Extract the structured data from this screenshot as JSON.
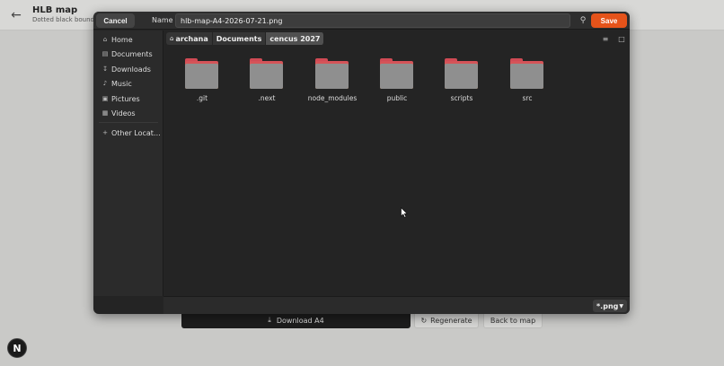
{
  "app": {
    "title": "HLB map",
    "subtitle": "Dotted black boundary",
    "buttons": {
      "download": "Download A4",
      "regenerate": "Regenerate",
      "back": "Back to map"
    },
    "badge": "N"
  },
  "dialog": {
    "cancel_label": "Cancel",
    "name_label": "Name",
    "filename": "hlb-map-A4-2026-07-21.png",
    "save_label": "Save",
    "accent_color": "#e5531a",
    "sidebar": [
      {
        "label": "Home",
        "icon": "home-icon"
      },
      {
        "label": "Documents",
        "icon": "document-icon"
      },
      {
        "label": "Downloads",
        "icon": "download-icon"
      },
      {
        "label": "Music",
        "icon": "music-icon"
      },
      {
        "label": "Pictures",
        "icon": "picture-icon"
      },
      {
        "label": "Videos",
        "icon": "video-icon"
      },
      {
        "label": "Other Locat…",
        "icon": "plus-icon"
      }
    ],
    "breadcrumb": [
      "archana",
      "Documents",
      "cencus 2027"
    ],
    "files": [
      ".git",
      ".next",
      "node_modules",
      "public",
      "scripts",
      "src"
    ],
    "filter": "*.png"
  }
}
